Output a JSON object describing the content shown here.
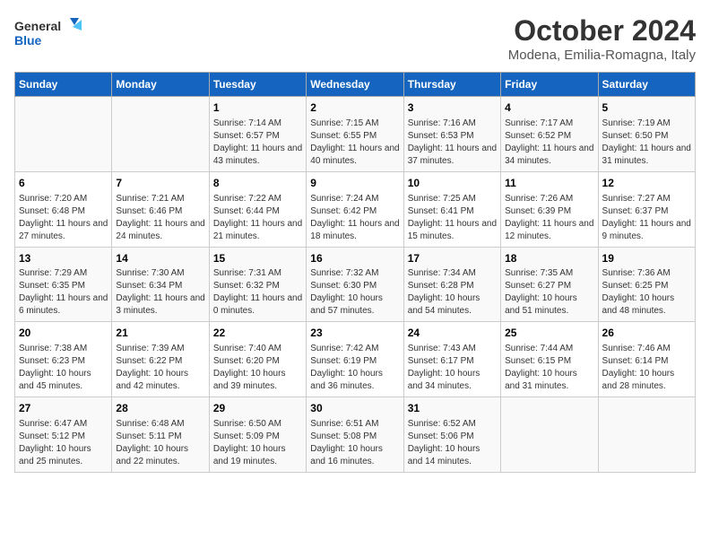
{
  "header": {
    "logo_general": "General",
    "logo_blue": "Blue",
    "month_title": "October 2024",
    "location": "Modena, Emilia-Romagna, Italy"
  },
  "days_of_week": [
    "Sunday",
    "Monday",
    "Tuesday",
    "Wednesday",
    "Thursday",
    "Friday",
    "Saturday"
  ],
  "weeks": [
    [
      {
        "day": "",
        "info": ""
      },
      {
        "day": "",
        "info": ""
      },
      {
        "day": "1",
        "info": "Sunrise: 7:14 AM\nSunset: 6:57 PM\nDaylight: 11 hours and 43 minutes."
      },
      {
        "day": "2",
        "info": "Sunrise: 7:15 AM\nSunset: 6:55 PM\nDaylight: 11 hours and 40 minutes."
      },
      {
        "day": "3",
        "info": "Sunrise: 7:16 AM\nSunset: 6:53 PM\nDaylight: 11 hours and 37 minutes."
      },
      {
        "day": "4",
        "info": "Sunrise: 7:17 AM\nSunset: 6:52 PM\nDaylight: 11 hours and 34 minutes."
      },
      {
        "day": "5",
        "info": "Sunrise: 7:19 AM\nSunset: 6:50 PM\nDaylight: 11 hours and 31 minutes."
      }
    ],
    [
      {
        "day": "6",
        "info": "Sunrise: 7:20 AM\nSunset: 6:48 PM\nDaylight: 11 hours and 27 minutes."
      },
      {
        "day": "7",
        "info": "Sunrise: 7:21 AM\nSunset: 6:46 PM\nDaylight: 11 hours and 24 minutes."
      },
      {
        "day": "8",
        "info": "Sunrise: 7:22 AM\nSunset: 6:44 PM\nDaylight: 11 hours and 21 minutes."
      },
      {
        "day": "9",
        "info": "Sunrise: 7:24 AM\nSunset: 6:42 PM\nDaylight: 11 hours and 18 minutes."
      },
      {
        "day": "10",
        "info": "Sunrise: 7:25 AM\nSunset: 6:41 PM\nDaylight: 11 hours and 15 minutes."
      },
      {
        "day": "11",
        "info": "Sunrise: 7:26 AM\nSunset: 6:39 PM\nDaylight: 11 hours and 12 minutes."
      },
      {
        "day": "12",
        "info": "Sunrise: 7:27 AM\nSunset: 6:37 PM\nDaylight: 11 hours and 9 minutes."
      }
    ],
    [
      {
        "day": "13",
        "info": "Sunrise: 7:29 AM\nSunset: 6:35 PM\nDaylight: 11 hours and 6 minutes."
      },
      {
        "day": "14",
        "info": "Sunrise: 7:30 AM\nSunset: 6:34 PM\nDaylight: 11 hours and 3 minutes."
      },
      {
        "day": "15",
        "info": "Sunrise: 7:31 AM\nSunset: 6:32 PM\nDaylight: 11 hours and 0 minutes."
      },
      {
        "day": "16",
        "info": "Sunrise: 7:32 AM\nSunset: 6:30 PM\nDaylight: 10 hours and 57 minutes."
      },
      {
        "day": "17",
        "info": "Sunrise: 7:34 AM\nSunset: 6:28 PM\nDaylight: 10 hours and 54 minutes."
      },
      {
        "day": "18",
        "info": "Sunrise: 7:35 AM\nSunset: 6:27 PM\nDaylight: 10 hours and 51 minutes."
      },
      {
        "day": "19",
        "info": "Sunrise: 7:36 AM\nSunset: 6:25 PM\nDaylight: 10 hours and 48 minutes."
      }
    ],
    [
      {
        "day": "20",
        "info": "Sunrise: 7:38 AM\nSunset: 6:23 PM\nDaylight: 10 hours and 45 minutes."
      },
      {
        "day": "21",
        "info": "Sunrise: 7:39 AM\nSunset: 6:22 PM\nDaylight: 10 hours and 42 minutes."
      },
      {
        "day": "22",
        "info": "Sunrise: 7:40 AM\nSunset: 6:20 PM\nDaylight: 10 hours and 39 minutes."
      },
      {
        "day": "23",
        "info": "Sunrise: 7:42 AM\nSunset: 6:19 PM\nDaylight: 10 hours and 36 minutes."
      },
      {
        "day": "24",
        "info": "Sunrise: 7:43 AM\nSunset: 6:17 PM\nDaylight: 10 hours and 34 minutes."
      },
      {
        "day": "25",
        "info": "Sunrise: 7:44 AM\nSunset: 6:15 PM\nDaylight: 10 hours and 31 minutes."
      },
      {
        "day": "26",
        "info": "Sunrise: 7:46 AM\nSunset: 6:14 PM\nDaylight: 10 hours and 28 minutes."
      }
    ],
    [
      {
        "day": "27",
        "info": "Sunrise: 6:47 AM\nSunset: 5:12 PM\nDaylight: 10 hours and 25 minutes."
      },
      {
        "day": "28",
        "info": "Sunrise: 6:48 AM\nSunset: 5:11 PM\nDaylight: 10 hours and 22 minutes."
      },
      {
        "day": "29",
        "info": "Sunrise: 6:50 AM\nSunset: 5:09 PM\nDaylight: 10 hours and 19 minutes."
      },
      {
        "day": "30",
        "info": "Sunrise: 6:51 AM\nSunset: 5:08 PM\nDaylight: 10 hours and 16 minutes."
      },
      {
        "day": "31",
        "info": "Sunrise: 6:52 AM\nSunset: 5:06 PM\nDaylight: 10 hours and 14 minutes."
      },
      {
        "day": "",
        "info": ""
      },
      {
        "day": "",
        "info": ""
      }
    ]
  ]
}
